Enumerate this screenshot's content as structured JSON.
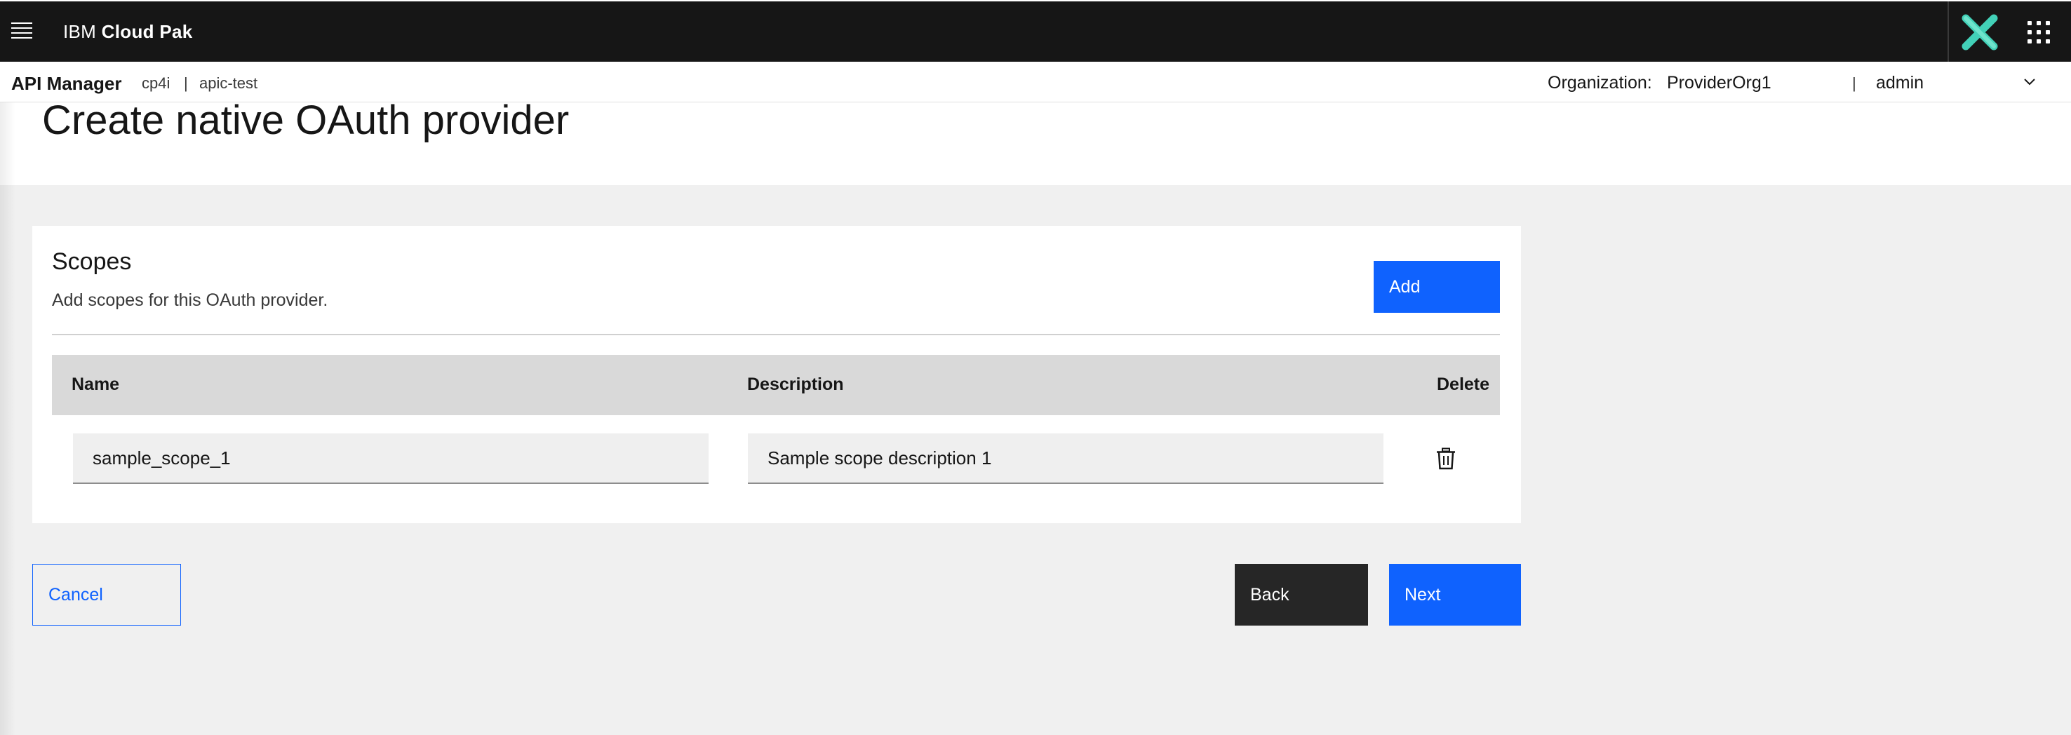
{
  "topbar": {
    "brand_prefix": "IBM",
    "brand_name": "Cloud Pak",
    "menu_icon": "hamburger-menu-icon",
    "app_switcher_icon": "app-switcher-grid-icon",
    "logo_icon": "x-logo-icon",
    "logo_color": "#42d1b8"
  },
  "subheader": {
    "app_name": "API Manager",
    "breadcrumb": [
      "cp4i",
      "|",
      "apic-test"
    ],
    "organization_label": "Organization:",
    "organization_value": "ProviderOrg1",
    "separator": "|",
    "user": "admin",
    "user_menu_icon": "chevron-down-icon"
  },
  "page": {
    "title": "Create native OAuth provider"
  },
  "scopes_card": {
    "title": "Scopes",
    "subtitle": "Add scopes for this OAuth provider.",
    "add_label": "Add",
    "columns": [
      "Name",
      "Description",
      "Delete"
    ],
    "rows": [
      {
        "name": "sample_scope_1",
        "description": "Sample scope description 1",
        "delete_icon": "trash-icon"
      }
    ]
  },
  "footer": {
    "cancel_label": "Cancel",
    "back_label": "Back",
    "next_label": "Next"
  },
  "colors": {
    "primary": "#0f62fe",
    "topbar_bg": "#161616",
    "page_bg": "#f0f0f0"
  }
}
